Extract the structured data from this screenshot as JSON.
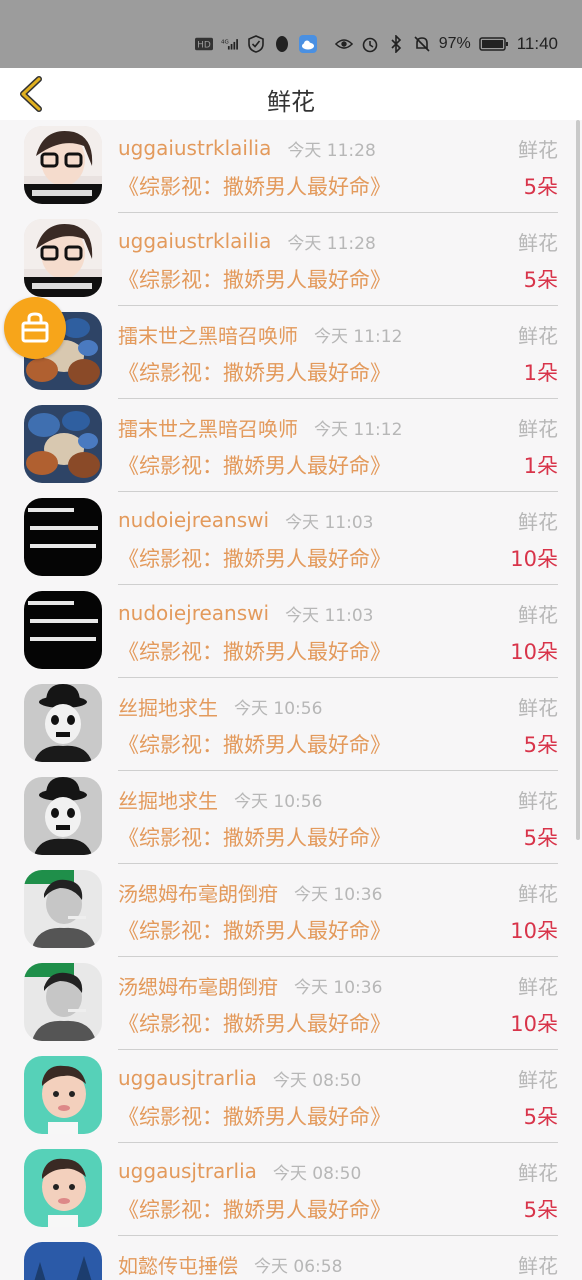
{
  "status_bar": {
    "battery": "97%",
    "time": "11:40",
    "network": "4G"
  },
  "header": {
    "title": "鲜花"
  },
  "rows": [
    {
      "user": "uggaiustrklailia",
      "time": "今天 11:28",
      "type": "鲜花",
      "book": "《综影视：撒娇男人最好命》",
      "count": "5朵",
      "avatar": "glasses-girl-avatar"
    },
    {
      "user": "uggaiustrklailia",
      "time": "今天 11:28",
      "type": "鲜花",
      "book": "《综影视：撒娇男人最好命》",
      "count": "5朵",
      "avatar": "glasses-girl-avatar"
    },
    {
      "user": "擂末世之黑暗召唤师",
      "time": "今天 11:12",
      "type": "鲜花",
      "book": "《综影视：撒娇男人最好命》",
      "count": "1朵",
      "avatar": "shells-avatar"
    },
    {
      "user": "擂末世之黑暗召唤师",
      "time": "今天 11:12",
      "type": "鲜花",
      "book": "《综影视：撒娇男人最好命》",
      "count": "1朵",
      "avatar": "shells-avatar"
    },
    {
      "user": "nudoiejreanswi",
      "time": "今天 11:03",
      "type": "鲜花",
      "book": "《综影视：撒娇男人最好命》",
      "count": "10朵",
      "avatar": "text-avatar"
    },
    {
      "user": "nudoiejreanswi",
      "time": "今天 11:03",
      "type": "鲜花",
      "book": "《综影视：撒娇男人最好命》",
      "count": "10朵",
      "avatar": "text-avatar"
    },
    {
      "user": "丝掘地求生",
      "time": "今天 10:56",
      "type": "鲜花",
      "book": "《综影视：撒娇男人最好命》",
      "count": "5朵",
      "avatar": "bowler-hat-avatar"
    },
    {
      "user": "丝掘地求生",
      "time": "今天 10:56",
      "type": "鲜花",
      "book": "《综影视：撒娇男人最好命》",
      "count": "5朵",
      "avatar": "bowler-hat-avatar"
    },
    {
      "user": "汤缌姆布毫朗倒疳",
      "time": "今天 10:36",
      "type": "鲜花",
      "book": "《综影视：撒娇男人最好命》",
      "count": "10朵",
      "avatar": "smoking-man-avatar"
    },
    {
      "user": "汤缌姆布毫朗倒疳",
      "time": "今天 10:36",
      "type": "鲜花",
      "book": "《综影视：撒娇男人最好命》",
      "count": "10朵",
      "avatar": "smoking-man-avatar"
    },
    {
      "user": "uggausjtrarlia",
      "time": "今天 08:50",
      "type": "鲜花",
      "book": "《综影视：撒娇男人最好命》",
      "count": "5朵",
      "avatar": "baby-avatar"
    },
    {
      "user": "uggausjtrarlia",
      "time": "今天 08:50",
      "type": "鲜花",
      "book": "《综影视：撒娇男人最好命》",
      "count": "5朵",
      "avatar": "baby-avatar"
    },
    {
      "user": "如懿传屯捶偿",
      "time": "今天 06:58",
      "type": "鲜花",
      "book": "",
      "count": "",
      "avatar": "winter-avatar"
    }
  ],
  "colors": {
    "username": "#e39a5c",
    "count": "#d8344a",
    "muted": "#b7b7b7",
    "accent": "#f7a51a",
    "back_arrow": "#e0b020"
  }
}
